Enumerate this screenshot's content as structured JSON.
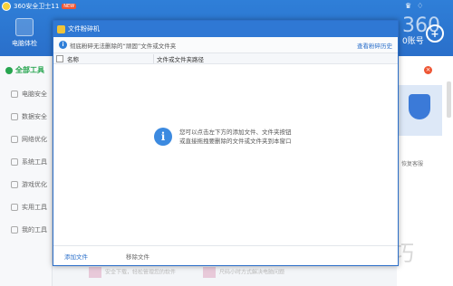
{
  "app": {
    "title": "360安全卫士11",
    "new_badge": "NEW",
    "tool_label": "电脑体检",
    "right_number_text": "0账号",
    "right_big_text": "360",
    "right_avatar_symbol": "+"
  },
  "sidebar": {
    "all_tools": "全部工具",
    "items": [
      "电脑安全",
      "数据安全",
      "网络优化",
      "系统工具",
      "游戏优化",
      "实用工具",
      "我的工具"
    ]
  },
  "right_panel": {
    "close_badge": "×",
    "card_text": "恢复客服"
  },
  "bottom_strip": {
    "item1": "安全下载，轻松管理您的软件",
    "item2": "尺码小时方式解决电脑问题"
  },
  "watermark": "软件技巧",
  "dialog": {
    "title": "文件粉碎机",
    "info_message": "彻底粉碎无法删除的“顽固”文件或文件夹",
    "history_link": "查看粉碎历史",
    "columns": {
      "name": "名称",
      "path": "文件或文件夹路径"
    },
    "hint_line1": "您可以点击左下方的添加文件、文件夹按钮",
    "hint_line2": "或直接拖拽要删除的文件或文件夹到本窗口",
    "add_file": "添加文件",
    "remove_file": "移除文件"
  }
}
